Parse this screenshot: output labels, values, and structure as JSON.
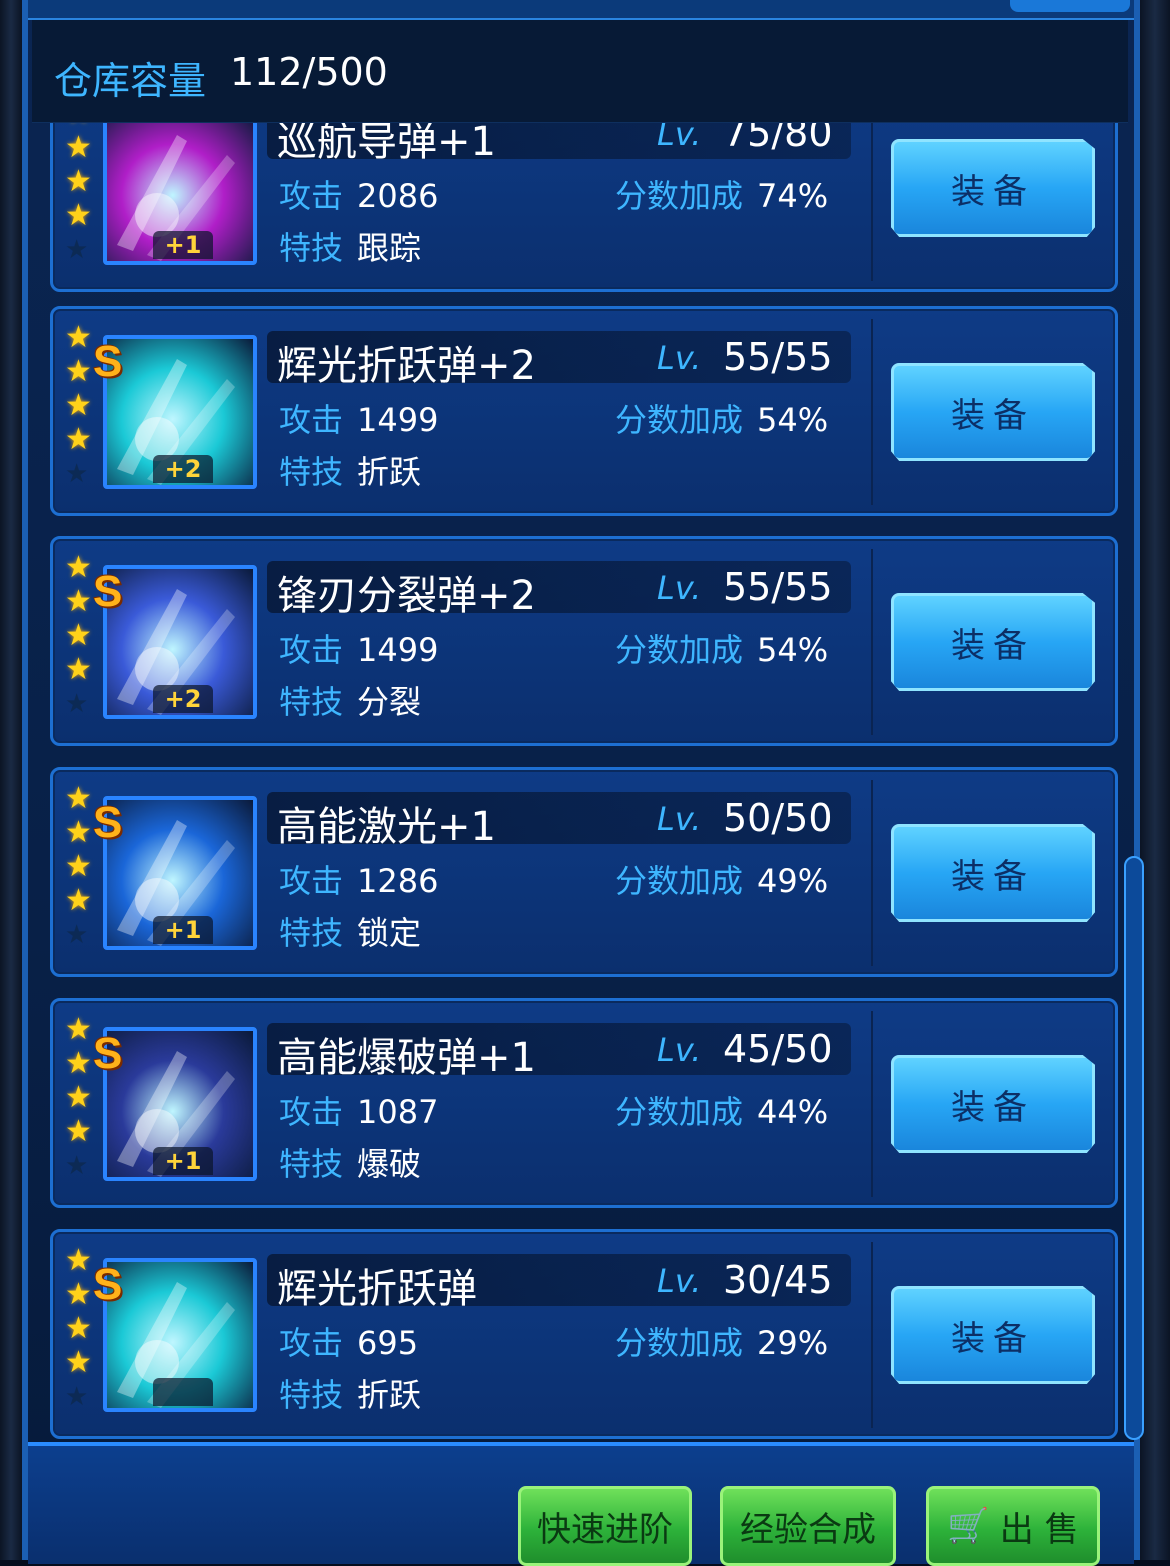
{
  "capacity": {
    "label": "仓库容量",
    "value": "112/500"
  },
  "labels": {
    "attack": "攻击",
    "bonus": "分数加成",
    "skill": "特技",
    "lv": "Lv.",
    "equip": "装备"
  },
  "items": [
    {
      "name": "巡航导弹+1",
      "lv": "75/80",
      "attack": "2086",
      "bonus": "74%",
      "skill": "跟踪",
      "plus": "+1",
      "rank": "",
      "stars": 4,
      "icon": "missile-icon",
      "color": "#b01ec8"
    },
    {
      "name": "辉光折跃弹+2",
      "lv": "55/55",
      "attack": "1499",
      "bonus": "54%",
      "skill": "折跃",
      "plus": "+2",
      "rank": "S",
      "stars": 4,
      "icon": "warp-icon",
      "color": "#1bc9d6"
    },
    {
      "name": "锋刃分裂弹+2",
      "lv": "55/55",
      "attack": "1499",
      "bonus": "54%",
      "skill": "分裂",
      "plus": "+2",
      "rank": "S",
      "stars": 4,
      "icon": "blade-icon",
      "color": "#3a5ad8"
    },
    {
      "name": "高能激光+1",
      "lv": "50/50",
      "attack": "1286",
      "bonus": "49%",
      "skill": "锁定",
      "plus": "+1",
      "rank": "S",
      "stars": 4,
      "icon": "laser-icon",
      "color": "#1a66d8"
    },
    {
      "name": "高能爆破弹+1",
      "lv": "45/50",
      "attack": "1087",
      "bonus": "44%",
      "skill": "爆破",
      "plus": "+1",
      "rank": "S",
      "stars": 4,
      "icon": "blast-icon",
      "color": "#2a3a9a"
    },
    {
      "name": "辉光折跃弹",
      "lv": "30/45",
      "attack": "695",
      "bonus": "29%",
      "skill": "折跃",
      "plus": "",
      "rank": "S",
      "stars": 4,
      "icon": "warp-icon",
      "color": "#1bc9d6"
    }
  ],
  "actions": {
    "quick": "快速进阶",
    "exp": "经验合成",
    "sell": "出 售"
  }
}
